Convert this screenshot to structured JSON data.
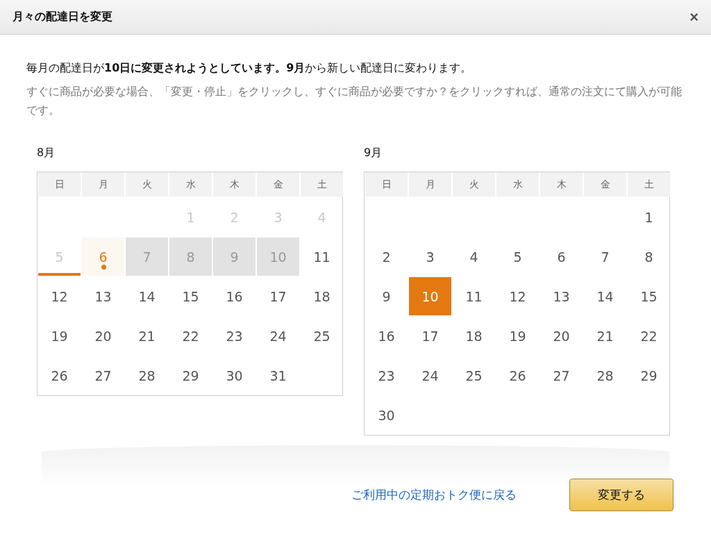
{
  "dialog": {
    "title": "月々の配達日を変更",
    "close": "×"
  },
  "message": {
    "headline": "毎月の配達日が**10日に変更されようとしています。9月**から新しい配達日に変わります。",
    "note": "すぐに商品が必要な場合、「変更・停止」をクリックし、すぐに商品が必要ですか？をクリックすれば、通常の注文にて購入が可能です。"
  },
  "calendars": [
    {
      "month": "8月",
      "weekdays": [
        "日",
        "月",
        "火",
        "水",
        "木",
        "金",
        "土"
      ],
      "weeks": [
        [
          {
            "kind": "blank"
          },
          {
            "kind": "blank"
          },
          {
            "kind": "blank"
          },
          {
            "day": "1",
            "kind": "past",
            "selected": false
          },
          {
            "day": "2",
            "kind": "past",
            "selected": false
          },
          {
            "day": "3",
            "kind": "past",
            "selected": false
          },
          {
            "day": "4",
            "kind": "past",
            "selected": false
          }
        ],
        [
          {
            "day": "5",
            "kind": "underlined",
            "selected": false
          },
          {
            "day": "6",
            "kind": "current",
            "selected": false
          },
          {
            "day": "7",
            "kind": "unavailable",
            "selected": false
          },
          {
            "day": "8",
            "kind": "unavailable",
            "selected": false
          },
          {
            "day": "9",
            "kind": "unavailable",
            "selected": false
          },
          {
            "day": "10",
            "kind": "unavailable",
            "selected": false
          },
          {
            "day": "11",
            "kind": "normal",
            "selected": false
          }
        ],
        [
          {
            "day": "12",
            "kind": "normal",
            "selected": false
          },
          {
            "day": "13",
            "kind": "normal",
            "selected": false
          },
          {
            "day": "14",
            "kind": "normal",
            "selected": false
          },
          {
            "day": "15",
            "kind": "normal",
            "selected": false
          },
          {
            "day": "16",
            "kind": "normal",
            "selected": false
          },
          {
            "day": "17",
            "kind": "normal",
            "selected": false
          },
          {
            "day": "18",
            "kind": "normal",
            "selected": false
          }
        ],
        [
          {
            "day": "19",
            "kind": "normal",
            "selected": false
          },
          {
            "day": "20",
            "kind": "normal",
            "selected": false
          },
          {
            "day": "21",
            "kind": "normal",
            "selected": false
          },
          {
            "day": "22",
            "kind": "normal",
            "selected": false
          },
          {
            "day": "23",
            "kind": "normal",
            "selected": false
          },
          {
            "day": "24",
            "kind": "normal",
            "selected": false
          },
          {
            "day": "25",
            "kind": "normal",
            "selected": false
          }
        ],
        [
          {
            "day": "26",
            "kind": "normal",
            "selected": false
          },
          {
            "day": "27",
            "kind": "normal",
            "selected": false
          },
          {
            "day": "28",
            "kind": "normal",
            "selected": false
          },
          {
            "day": "29",
            "kind": "normal",
            "selected": false
          },
          {
            "day": "30",
            "kind": "normal",
            "selected": false
          },
          {
            "day": "31",
            "kind": "normal",
            "selected": false
          },
          {
            "kind": "blank"
          }
        ]
      ]
    },
    {
      "month": "9月",
      "weekdays": [
        "日",
        "月",
        "火",
        "水",
        "木",
        "金",
        "土"
      ],
      "weeks": [
        [
          {
            "kind": "blank"
          },
          {
            "kind": "blank"
          },
          {
            "kind": "blank"
          },
          {
            "kind": "blank"
          },
          {
            "kind": "blank"
          },
          {
            "kind": "blank"
          },
          {
            "day": "1",
            "kind": "normal",
            "selected": false
          }
        ],
        [
          {
            "day": "2",
            "kind": "normal",
            "selected": false
          },
          {
            "day": "3",
            "kind": "normal",
            "selected": false
          },
          {
            "day": "4",
            "kind": "normal",
            "selected": false
          },
          {
            "day": "5",
            "kind": "normal",
            "selected": false
          },
          {
            "day": "6",
            "kind": "normal",
            "selected": false
          },
          {
            "day": "7",
            "kind": "normal",
            "selected": false
          },
          {
            "day": "8",
            "kind": "normal",
            "selected": false
          }
        ],
        [
          {
            "day": "9",
            "kind": "normal",
            "selected": false
          },
          {
            "day": "10",
            "kind": "normal",
            "selected": true
          },
          {
            "day": "11",
            "kind": "normal",
            "selected": false
          },
          {
            "day": "12",
            "kind": "normal",
            "selected": false
          },
          {
            "day": "13",
            "kind": "normal",
            "selected": false
          },
          {
            "day": "14",
            "kind": "normal",
            "selected": false
          },
          {
            "day": "15",
            "kind": "normal",
            "selected": false
          }
        ],
        [
          {
            "day": "16",
            "kind": "normal",
            "selected": false
          },
          {
            "day": "17",
            "kind": "normal",
            "selected": false
          },
          {
            "day": "18",
            "kind": "normal",
            "selected": false
          },
          {
            "day": "19",
            "kind": "normal",
            "selected": false
          },
          {
            "day": "20",
            "kind": "normal",
            "selected": false
          },
          {
            "day": "21",
            "kind": "normal",
            "selected": false
          },
          {
            "day": "22",
            "kind": "normal",
            "selected": false
          }
        ],
        [
          {
            "day": "23",
            "kind": "normal",
            "selected": false
          },
          {
            "day": "24",
            "kind": "normal",
            "selected": false
          },
          {
            "day": "25",
            "kind": "normal",
            "selected": false
          },
          {
            "day": "26",
            "kind": "normal",
            "selected": false
          },
          {
            "day": "27",
            "kind": "normal",
            "selected": false
          },
          {
            "day": "28",
            "kind": "normal",
            "selected": false
          },
          {
            "day": "29",
            "kind": "normal",
            "selected": false
          }
        ],
        [
          {
            "day": "30",
            "kind": "normal",
            "selected": false
          },
          {
            "kind": "blank"
          },
          {
            "kind": "blank"
          },
          {
            "kind": "blank"
          },
          {
            "kind": "blank"
          },
          {
            "kind": "blank"
          },
          {
            "kind": "blank"
          }
        ]
      ]
    }
  ],
  "footer": {
    "back_link": "ご利用中の定期おトク便に戻る",
    "confirm_button": "変更する"
  }
}
